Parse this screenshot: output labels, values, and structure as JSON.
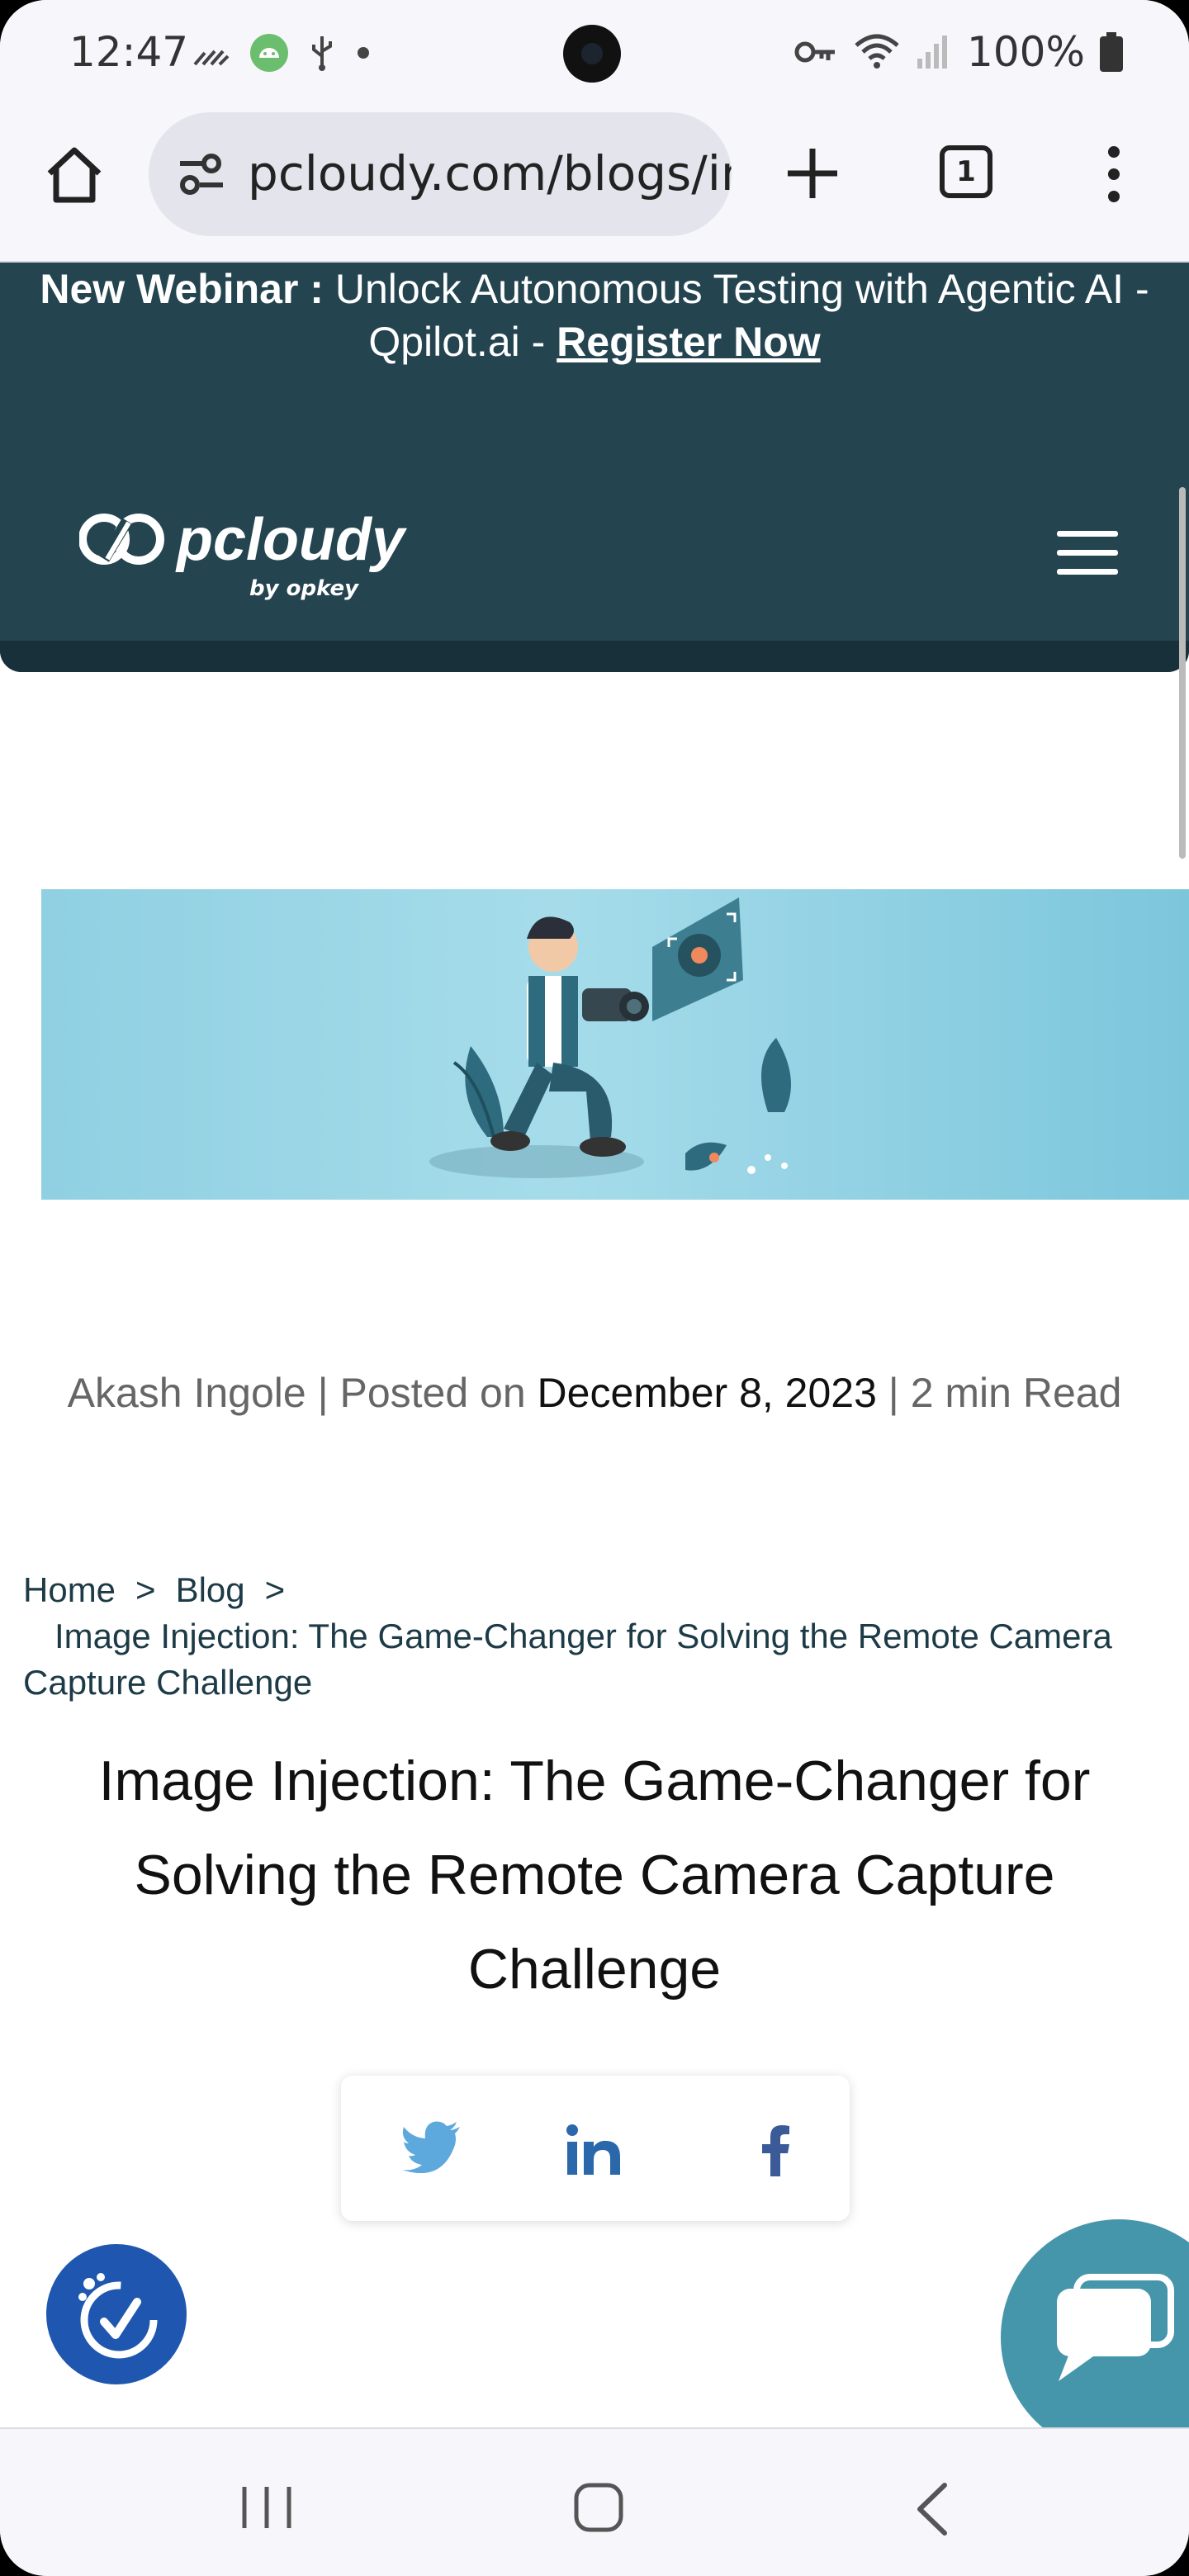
{
  "status_bar": {
    "time": "12:47",
    "battery": "100%"
  },
  "browser": {
    "url": "pcloudy.com/blogs/image-injection",
    "tab_count": "1"
  },
  "announcement": {
    "prefix": "New Webinar :",
    "text": " Unlock Autonomous Testing with Agentic AI - Qpilot.ai - ",
    "link": "Register Now"
  },
  "brand": {
    "name": "pcloudy",
    "sub": "by opkey"
  },
  "post": {
    "author": "Akash Ingole",
    "posted_on_label": "Posted on",
    "date": "December 8, 2023",
    "read_time": "2 min Read",
    "title": "Image Injection: The Game-Changer for Solving the Remote Camera Capture Challenge"
  },
  "breadcrumb": {
    "home": "Home",
    "blog": "Blog",
    "current": "Image Injection: The Game-Changer for Solving the Remote Camera Capture Challenge",
    "separator": ">"
  },
  "share": {
    "icons": [
      "twitter-icon",
      "linkedin-icon",
      "facebook-icon"
    ]
  },
  "colors": {
    "header_bg": "#244450",
    "accent_blue": "#1f57b0",
    "chat_teal": "#4596ab"
  }
}
